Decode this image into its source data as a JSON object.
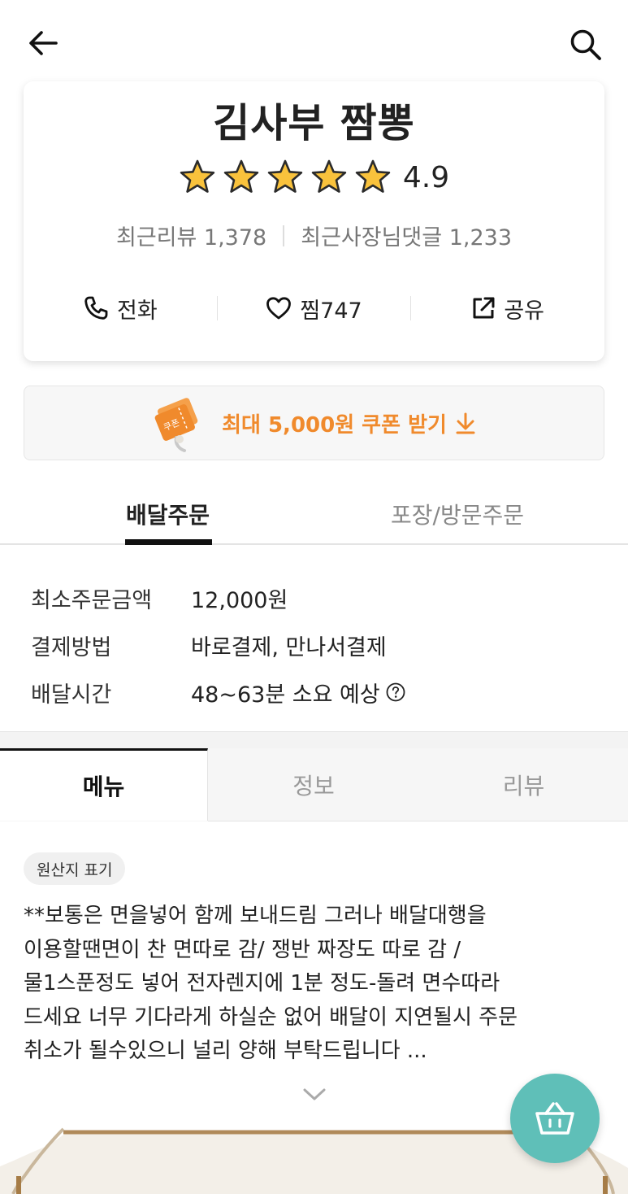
{
  "header": {
    "back_icon": "arrow-left-icon",
    "search_icon": "search-icon"
  },
  "store": {
    "name": "김사부 짬뽕",
    "rating": "4.9",
    "stars": 5,
    "recent_reviews": "최근리뷰 1,378",
    "owner_replies": "최근사장님댓글 1,233"
  },
  "actions": {
    "call_label": "전화",
    "like_label": "찜",
    "like_count": "747",
    "share_label": "공유"
  },
  "coupon": {
    "label": "최대 5,000원 쿠폰 받기",
    "ticket_text": "쿠폰",
    "accent": "#f08a2c"
  },
  "order_tabs": [
    {
      "label": "배달주문",
      "active": true
    },
    {
      "label": "포장/방문주문",
      "active": false
    }
  ],
  "order_info": [
    {
      "label": "최소주문금액",
      "value": "12,000원"
    },
    {
      "label": "결제방법",
      "value": "바로결제, 만나서결제"
    },
    {
      "label": "배달시간",
      "value": "48~63분 소요 예상"
    }
  ],
  "menu_tabs": [
    {
      "label": "메뉴",
      "active": true
    },
    {
      "label": "정보",
      "active": false
    },
    {
      "label": "리뷰",
      "active": false
    }
  ],
  "origin_badge": "원산지 표기",
  "notice_text": "**보통은 면을넣어 함께 보내드림 그러나  배달대행을\n이용할땐면이  찬 면따로 감/ 쟁반 짜장도 따로 감 /\n물1스푼정도 넣어 전자렌지에 1분 정도-돌려 면수따라\n드세요 너무 기다라게 하실순 없어 배달이 지연될시 주문\n취소가 될수있으니 널리 양해 부탁드립니다  ...",
  "cart": {
    "icon": "shopping-basket-icon",
    "color": "#5fbfb8"
  }
}
